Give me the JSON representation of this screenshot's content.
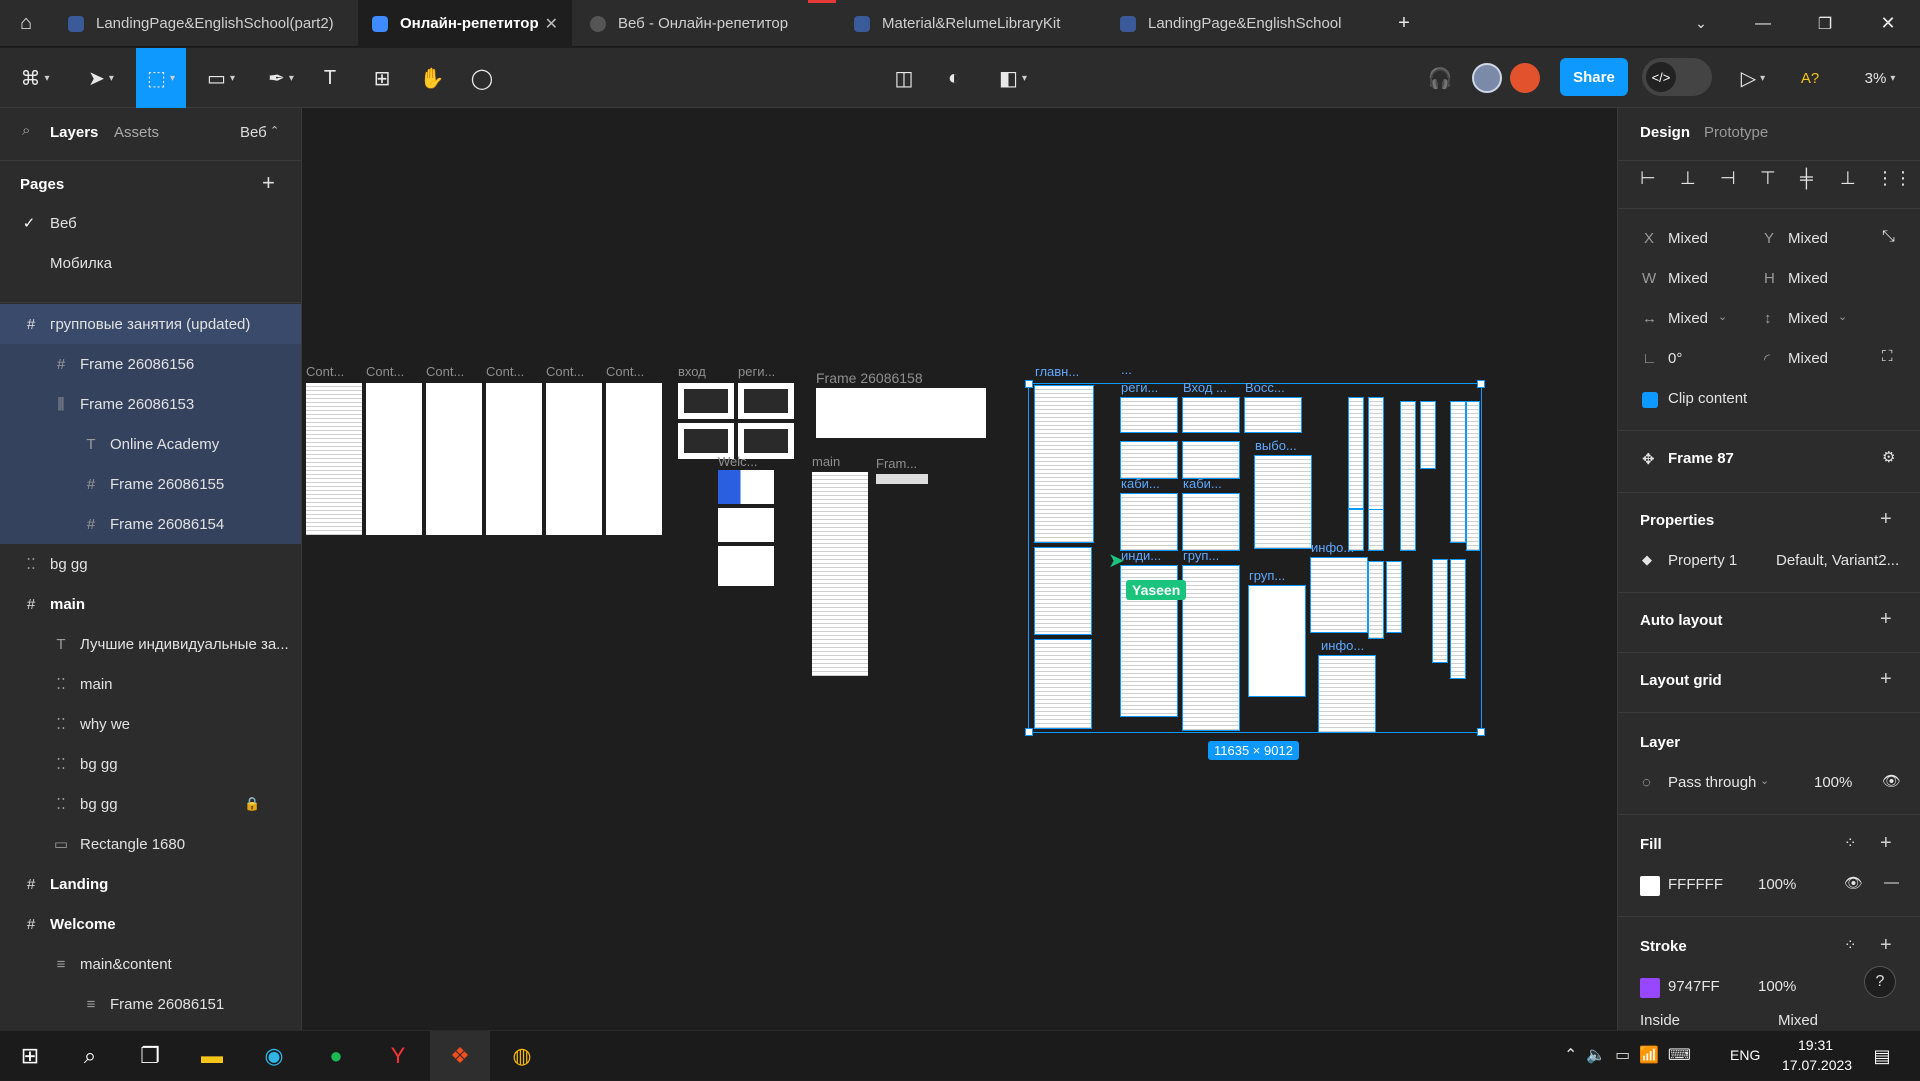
{
  "tabs": [
    {
      "label": "LandingPage&EnglishSchool(part2)"
    },
    {
      "label": "Онлайн-репетитор"
    },
    {
      "label": "Веб - Онлайн-репетитор"
    },
    {
      "label": "Material&RelumeLibraryKit"
    },
    {
      "label": "LandingPage&EnglishSchool"
    }
  ],
  "toolbar": {
    "share": "Share",
    "font_icon": "A?",
    "zoom": "3%"
  },
  "left": {
    "tab_layers": "Layers",
    "tab_assets": "Assets",
    "page_selector": "Веб",
    "pages_title": "Pages",
    "pages": [
      {
        "label": "Веб"
      },
      {
        "label": "Мобилка"
      }
    ],
    "layers": [
      {
        "label": "групповые занятия (updated)"
      },
      {
        "label": "Frame 26086156"
      },
      {
        "label": "Frame 26086153"
      },
      {
        "label": "Online Academy"
      },
      {
        "label": "Frame 26086155"
      },
      {
        "label": "Frame 26086154"
      },
      {
        "label": "bg gg"
      },
      {
        "label": "main"
      },
      {
        "label": "Лучшие индивидуальные за..."
      },
      {
        "label": "main"
      },
      {
        "label": "why we"
      },
      {
        "label": "bg gg"
      },
      {
        "label": "bg gg"
      },
      {
        "label": "Rectangle 1680"
      },
      {
        "label": "Landing"
      },
      {
        "label": "Welcome"
      },
      {
        "label": "main&content"
      },
      {
        "label": "Frame 26086151"
      }
    ]
  },
  "canvas": {
    "cont_labels": [
      "Cont...",
      "Cont...",
      "Cont...",
      "Cont...",
      "Cont...",
      "Cont..."
    ],
    "vhod": "вход",
    "regi": "реги...",
    "welc": "Welc...",
    "frame158": "Frame 26086158",
    "main": "main",
    "fram": "Fram...",
    "group_labels": {
      "glavn": "главн...",
      "dots": "...",
      "regi2": "реги...",
      "vhod2": "Вход ...",
      "voss": "Восс...",
      "vybo": "выбо...",
      "kabi1": "каби...",
      "kabi2": "каби...",
      "indi": "инди...",
      "grup1": "груп...",
      "grup2": "груп...",
      "info1": "инфо...",
      "info2": "инфо..."
    },
    "cursor_user": "Yaseen",
    "size_badge": "11635 × 9012"
  },
  "right": {
    "tab_design": "Design",
    "tab_prototype": "Prototype",
    "x_label": "X",
    "x_val": "Mixed",
    "y_label": "Y",
    "y_val": "Mixed",
    "w_label": "W",
    "w_val": "Mixed",
    "h_label": "H",
    "h_val": "Mixed",
    "hres": "Mixed",
    "vres": "Mixed",
    "rotation": "0°",
    "radius": "Mixed",
    "clip": "Clip content",
    "component": "Frame 87",
    "properties": "Properties",
    "prop1_name": "Property 1",
    "prop1_val": "Default, Variant2...",
    "auto_layout": "Auto layout",
    "layout_grid": "Layout grid",
    "layer": "Layer",
    "blend": "Pass through",
    "opacity": "100%",
    "fill": "Fill",
    "fill_hex": "FFFFFF",
    "fill_opacity": "100%",
    "fill_color": "#FFFFFF",
    "stroke": "Stroke",
    "stroke_hex": "9747FF",
    "stroke_opacity": "100%",
    "stroke_color": "#9747FF",
    "stroke_pos": "Inside",
    "stroke_w": "Mixed",
    "help": "?"
  },
  "taskbar": {
    "lang": "ENG",
    "time": "19:31",
    "date": "17.07.2023"
  },
  "colors": {
    "accent": "#0D99FF",
    "cursor": "#1BC47D"
  }
}
